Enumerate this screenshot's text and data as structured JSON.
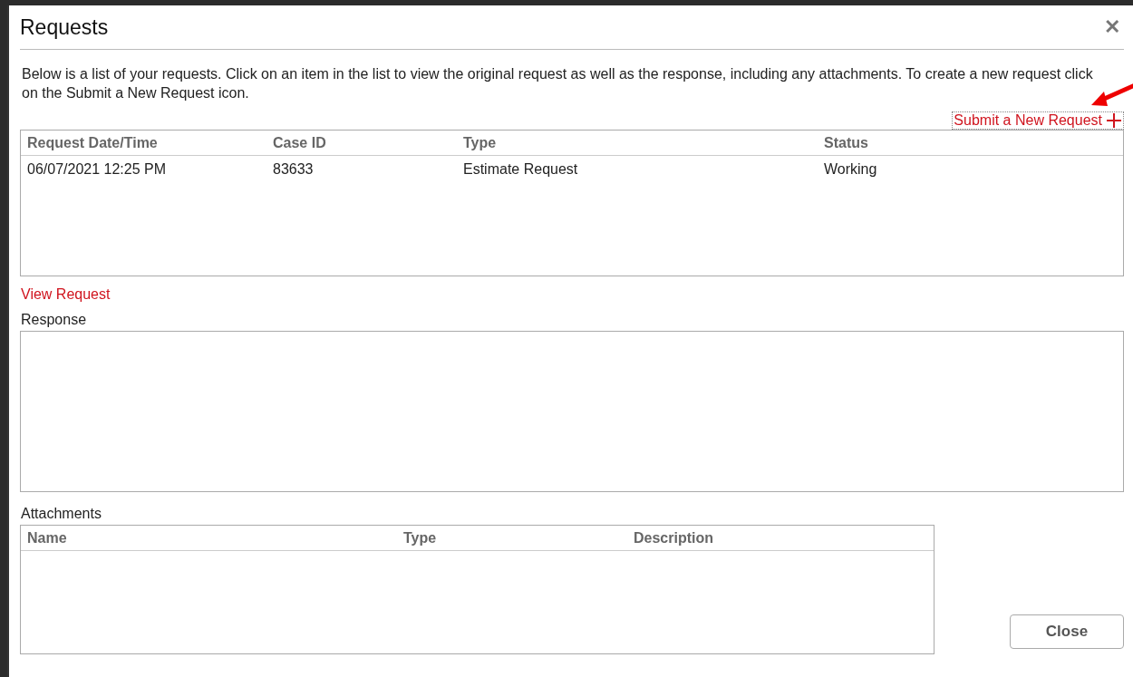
{
  "window": {
    "title": "Requests",
    "close_icon": "✕"
  },
  "intro": "Below is a list of your requests. Click on an item in the list to view the original request as well as the response, including any attachments. To create a new request click on the Submit a New Request icon.",
  "submit_link": {
    "label": "Submit a New Request"
  },
  "requests_table": {
    "columns": [
      "Request Date/Time",
      "Case ID",
      "Type",
      "Status"
    ],
    "rows": [
      {
        "cells": [
          "06/07/2021 12:25 PM",
          "83633",
          "Estimate Request",
          "Working"
        ],
        "selected": false
      }
    ]
  },
  "view_request_link": "View Request",
  "response": {
    "label": "Response"
  },
  "attachments": {
    "label": "Attachments",
    "columns": [
      "Name",
      "Type",
      "Description"
    ]
  },
  "buttons": [
    "Close"
  ]
}
